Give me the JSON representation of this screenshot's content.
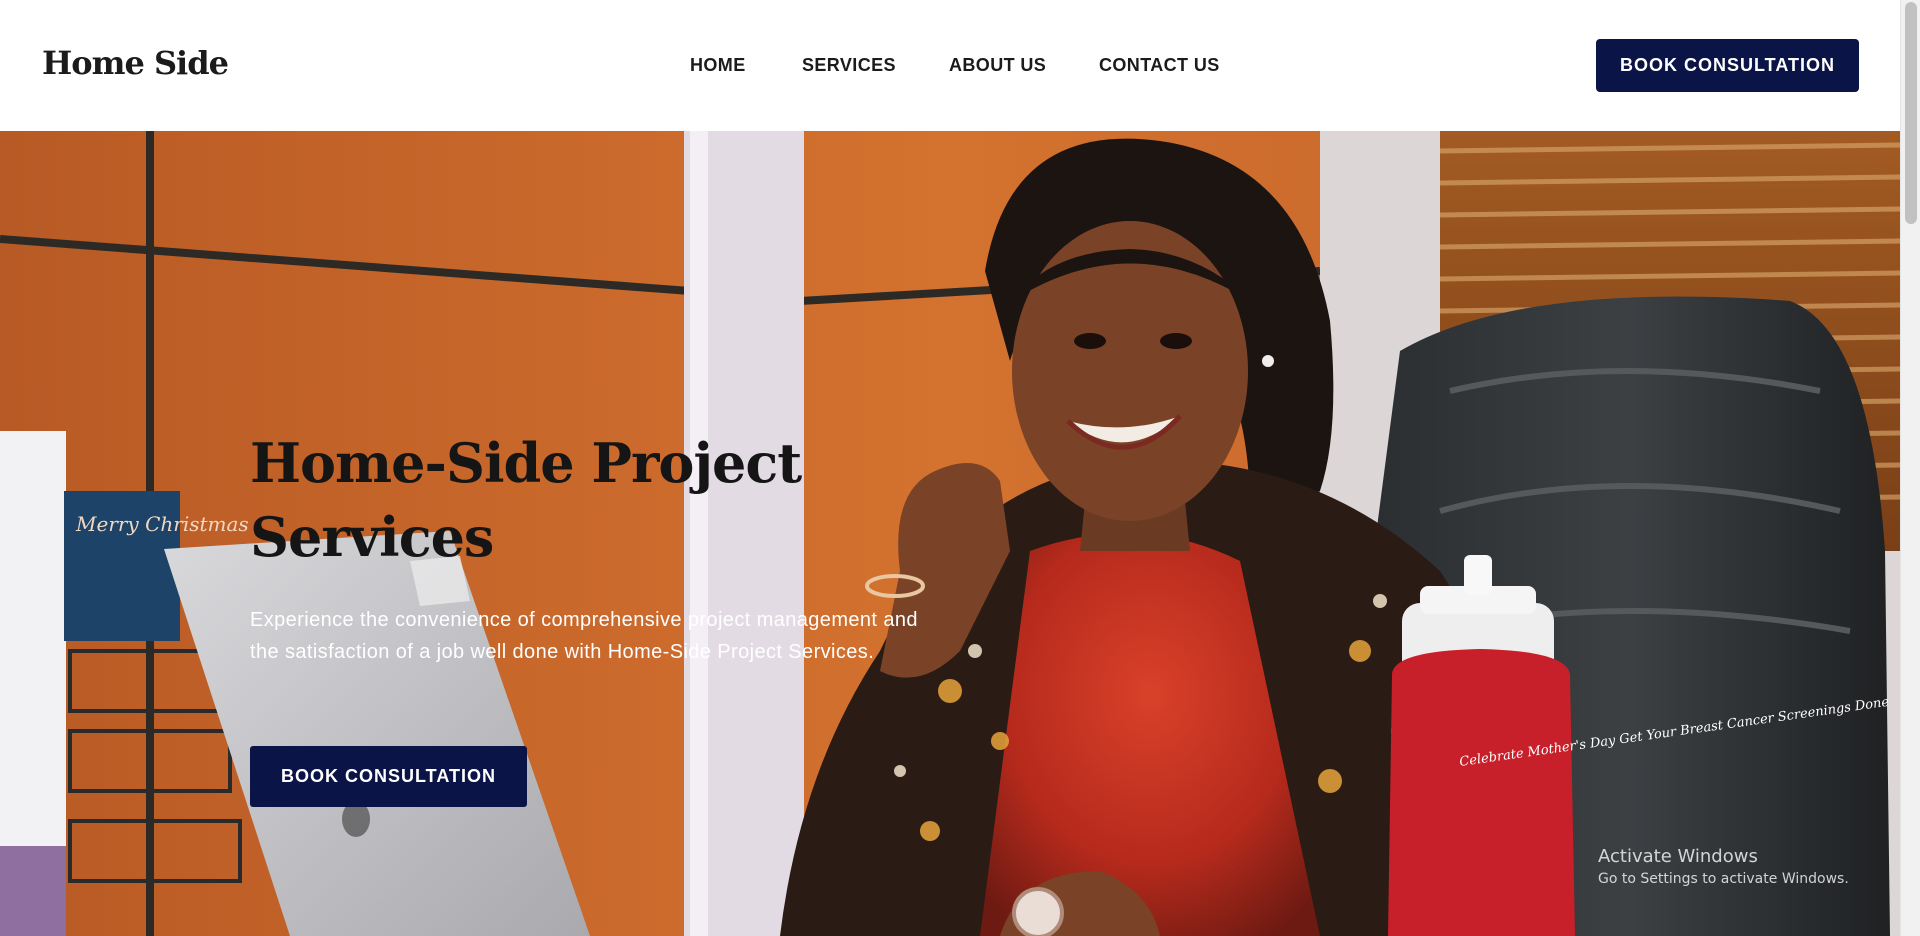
{
  "brand": {
    "logo_text": "Home Side"
  },
  "nav": {
    "items": [
      {
        "label": "HOME"
      },
      {
        "label": "SERVICES"
      },
      {
        "label": "ABOUT US"
      },
      {
        "label": "CONTACT US"
      }
    ],
    "cta_label": "BOOK CONSULTATION"
  },
  "hero": {
    "title": "Home-Side Project Services",
    "description": "Experience the convenience of comprehensive project management and the satisfaction of a job well done with Home-Side Project Services.",
    "cta_label": "BOOK CONSULTATION",
    "image": {
      "card_text": "Merry Christmas",
      "bottle_text": "Celebrate Mother's Day Get Your Breast Cancer Screenings Done"
    }
  },
  "os_overlay": {
    "title": "Activate Windows",
    "subtitle": "Go to Settings to activate Windows."
  },
  "colors": {
    "primary_button": "#0b1446",
    "wood_panel": "#c9652b",
    "text_dark": "#151515"
  }
}
